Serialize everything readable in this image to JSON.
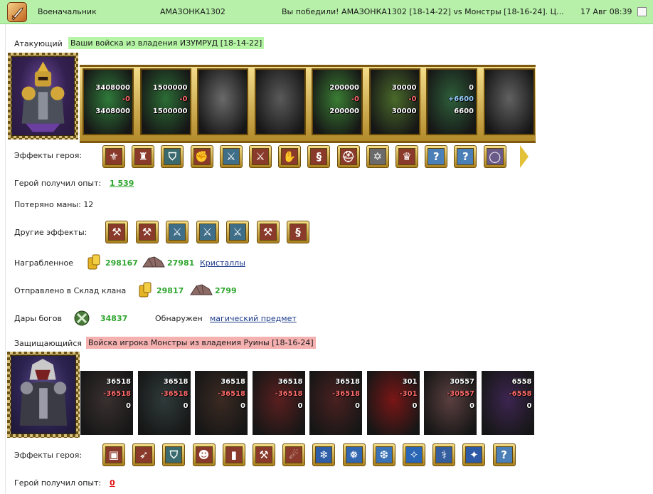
{
  "header": {
    "title": "Военачальник",
    "player": "АМАЗОНКА1302",
    "result": "Вы победили! АМАЗОНКА1302 [18-14-22] vs Монстры [18-16-24]. Ц...",
    "datetime": "17 Авг 08:39"
  },
  "attacker": {
    "label": "Атакующий",
    "army_tag": "Ваши войска из владения ИЗУМРУД [18-14-22]",
    "units": [
      {
        "top": "3408000",
        "mid": "-0",
        "bottom": "3408000",
        "color": "#2f7a3a"
      },
      {
        "top": "1500000",
        "mid": "-0",
        "bottom": "1500000",
        "color": "#2c6d35"
      },
      {
        "top": "",
        "mid": "",
        "bottom": "",
        "color": "#6a6a6a"
      },
      {
        "top": "",
        "mid": "",
        "bottom": "",
        "color": "#5a5a5a"
      },
      {
        "top": "200000",
        "mid": "-0",
        "bottom": "200000",
        "color": "#3a7d33"
      },
      {
        "top": "30000",
        "mid": "-0",
        "bottom": "30000",
        "color": "#4a6a2a"
      },
      {
        "top": "0",
        "mid": "+6600",
        "bottom": "6600",
        "color": "#2e5f3a"
      },
      {
        "top": "",
        "mid": "",
        "bottom": "",
        "color": "#616161"
      }
    ],
    "effects_label": "Эффекты героя:",
    "exp_label": "Герой получил опыт:",
    "exp_value": "1 539",
    "mana_label": "Потеряно маны: 12",
    "other_effects_label": "Другие эффекты:",
    "loot_label": "Награбленное",
    "loot_gold": "298167",
    "loot_ore": "27981",
    "loot_link": "Кристаллы",
    "clan_label": "Отправлено в Склад клана",
    "clan_gold": "29817",
    "clan_ore": "2799",
    "gifts_label": "Дары богов",
    "gifts_value": "34837",
    "found_label": "Обнаружен",
    "found_link": "магический предмет"
  },
  "defender": {
    "label": "Защищающийся",
    "army_tag": "Войска игрока Монстры из владения Руины [18-16-24]",
    "units": [
      {
        "top": "36518",
        "mid": "-36518",
        "bottom": "0",
        "color": "#3a3030"
      },
      {
        "top": "36518",
        "mid": "-36518",
        "bottom": "0",
        "color": "#2f3a3a"
      },
      {
        "top": "36518",
        "mid": "-36518",
        "bottom": "0",
        "color": "#3b2a22"
      },
      {
        "top": "36518",
        "mid": "-36518",
        "bottom": "0",
        "color": "#5a1f1f"
      },
      {
        "top": "36518",
        "mid": "-36518",
        "bottom": "0",
        "color": "#4a2020"
      },
      {
        "top": "301",
        "mid": "-301",
        "bottom": "0",
        "color": "#7a1616"
      },
      {
        "top": "30557",
        "mid": "-30557",
        "bottom": "0",
        "color": "#5b3f3f"
      },
      {
        "top": "6558",
        "mid": "-6558",
        "bottom": "0",
        "color": "#3c2550"
      }
    ],
    "effects_label": "Эффекты героя:",
    "exp_label": "Герой получил опыт:",
    "exp_value": "0"
  },
  "icons": {
    "attacker_effects": [
      "horn-shield-icon",
      "helmet-cards-icon",
      "shield-icon",
      "hand-shield-icon",
      "sword-icon",
      "sword-hand-icon",
      "hand-icon",
      "scroll-icon",
      "helmet-icon",
      "pentagram-icon",
      "crown-icon",
      "question-icon",
      "question-icon",
      "ring-icon"
    ],
    "other_effects": [
      "sword-axe-icon",
      "sword-axe-icon",
      "sword-icon",
      "sword-icon",
      "sword-icon",
      "sword-axe-icon",
      "scroll-icon"
    ],
    "defender_effects": [
      "chest-icon",
      "arrows-icon",
      "shield-icon",
      "face-icon",
      "pillar-icon",
      "hammers-icon",
      "beast-icon",
      "frost-icon",
      "frost-armor-icon",
      "frost-chain-icon",
      "frost-bolt-icon",
      "frost-staff-icon",
      "frost-rune-icon",
      "question-icon"
    ]
  }
}
